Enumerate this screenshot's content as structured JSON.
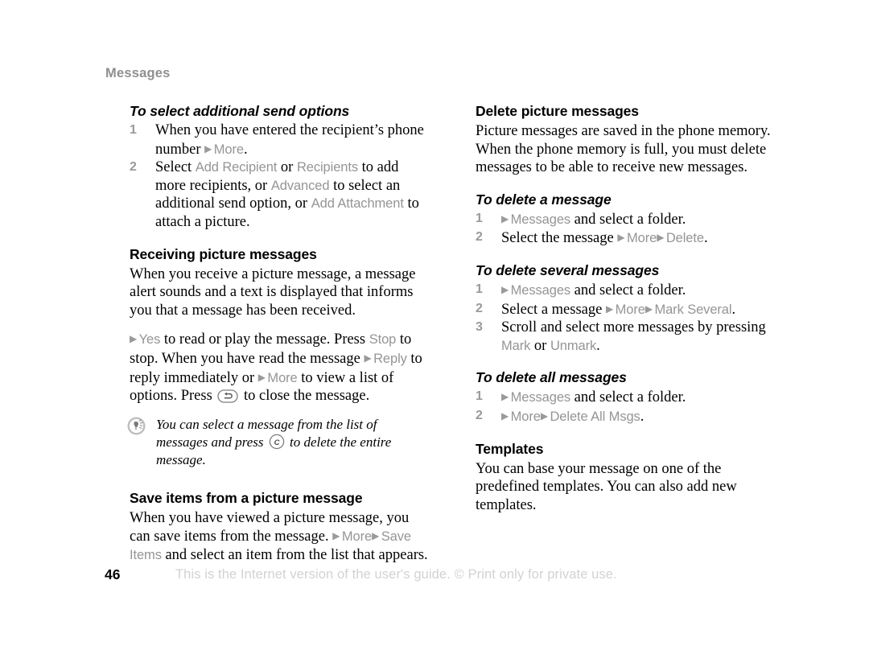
{
  "header": {
    "running_head": "Messages"
  },
  "colors": {
    "command_gray": "#959595",
    "running_head_gray": "#8f8f8f",
    "step_number_gray": "#9a9a9a",
    "footer_note_gray": "#d2d2d2",
    "body_black": "#000000"
  },
  "left_column": {
    "proc_send_options": {
      "heading": "To select additional send options",
      "steps": [
        {
          "num": "1",
          "parts": [
            {
              "type": "text",
              "value": "When you have entered the recipient’s phone number "
            },
            {
              "type": "arrow",
              "value": "▶"
            },
            {
              "type": "cmd",
              "value": "More"
            },
            {
              "type": "text",
              "value": "."
            }
          ]
        },
        {
          "num": "2",
          "parts": [
            {
              "type": "text",
              "value": "Select "
            },
            {
              "type": "cmd",
              "value": "Add Recipient"
            },
            {
              "type": "text",
              "value": " or "
            },
            {
              "type": "cmd",
              "value": "Recipients"
            },
            {
              "type": "text",
              "value": " to add more recipients, or "
            },
            {
              "type": "cmd",
              "value": "Advanced"
            },
            {
              "type": "text",
              "value": " to select an additional send option, or "
            },
            {
              "type": "cmd",
              "value": "Add Attachment"
            },
            {
              "type": "text",
              "value": " to attach a picture."
            }
          ]
        }
      ]
    },
    "sec_receiving": {
      "heading": "Receiving picture messages",
      "paragraph": "When you receive a picture message, a message alert sounds and a text is displayed that informs you that a message has been received.",
      "instruction_parts": [
        {
          "type": "arrow",
          "value": "▶"
        },
        {
          "type": "cmd",
          "value": "Yes"
        },
        {
          "type": "text",
          "value": " to read or play the message. Press "
        },
        {
          "type": "cmd",
          "value": "Stop"
        },
        {
          "type": "text",
          "value": " to stop. When you have read the message "
        },
        {
          "type": "arrow",
          "value": "▶"
        },
        {
          "type": "cmd",
          "value": "Reply"
        },
        {
          "type": "text",
          "value": " to reply immediately or "
        },
        {
          "type": "arrow",
          "value": "▶"
        },
        {
          "type": "cmd",
          "value": "More"
        },
        {
          "type": "text",
          "value": " to view a list of options. Press "
        },
        {
          "type": "key",
          "value": "back-key-icon"
        },
        {
          "type": "text",
          "value": " to close the message."
        }
      ]
    },
    "tip": {
      "icon": "lightbulb-tip-icon",
      "parts": [
        {
          "type": "text",
          "value": "You can select a message from the list of messages and press "
        },
        {
          "type": "key",
          "value": "clear-key-icon"
        },
        {
          "type": "text",
          "value": " to delete the entire message."
        }
      ]
    },
    "sec_save_items": {
      "heading": "Save items from a picture message",
      "parts": [
        {
          "type": "text",
          "value": "When you have viewed a picture message, you can save items from the message. "
        },
        {
          "type": "arrow",
          "value": "▶"
        },
        {
          "type": "cmd",
          "value": "More"
        },
        {
          "type": "arrow",
          "value": "▶"
        },
        {
          "type": "cmd",
          "value": "Save Items"
        },
        {
          "type": "text",
          "value": " and select an item from the list that appears."
        }
      ]
    }
  },
  "right_column": {
    "sec_delete": {
      "heading": "Delete picture messages",
      "paragraph": "Picture messages are saved in the phone memory. When the phone memory is full, you must delete messages to be able to receive new messages."
    },
    "proc_delete_one": {
      "heading": "To delete a message",
      "steps": [
        {
          "num": "1",
          "parts": [
            {
              "type": "arrow",
              "value": "▶"
            },
            {
              "type": "cmd",
              "value": "Messages"
            },
            {
              "type": "text",
              "value": " and select a folder."
            }
          ]
        },
        {
          "num": "2",
          "parts": [
            {
              "type": "text",
              "value": "Select the message "
            },
            {
              "type": "arrow",
              "value": "▶"
            },
            {
              "type": "cmd",
              "value": "More"
            },
            {
              "type": "arrow",
              "value": "▶"
            },
            {
              "type": "cmd",
              "value": "Delete"
            },
            {
              "type": "text",
              "value": "."
            }
          ]
        }
      ]
    },
    "proc_delete_several": {
      "heading": "To delete several messages",
      "steps": [
        {
          "num": "1",
          "parts": [
            {
              "type": "arrow",
              "value": "▶"
            },
            {
              "type": "cmd",
              "value": "Messages"
            },
            {
              "type": "text",
              "value": " and select a folder."
            }
          ]
        },
        {
          "num": "2",
          "parts": [
            {
              "type": "text",
              "value": "Select a message "
            },
            {
              "type": "arrow",
              "value": "▶"
            },
            {
              "type": "cmd",
              "value": "More"
            },
            {
              "type": "arrow",
              "value": "▶"
            },
            {
              "type": "cmd",
              "value": "Mark Several"
            },
            {
              "type": "text",
              "value": "."
            }
          ]
        },
        {
          "num": "3",
          "parts": [
            {
              "type": "text",
              "value": "Scroll and select more messages by pressing "
            },
            {
              "type": "cmd",
              "value": "Mark"
            },
            {
              "type": "text",
              "value": " or "
            },
            {
              "type": "cmd",
              "value": "Unmark"
            },
            {
              "type": "text",
              "value": "."
            }
          ]
        }
      ]
    },
    "proc_delete_all": {
      "heading": "To delete all messages",
      "steps": [
        {
          "num": "1",
          "parts": [
            {
              "type": "arrow",
              "value": "▶"
            },
            {
              "type": "cmd",
              "value": "Messages"
            },
            {
              "type": "text",
              "value": " and select a folder."
            }
          ]
        },
        {
          "num": "2",
          "parts": [
            {
              "type": "arrow",
              "value": "▶"
            },
            {
              "type": "cmd",
              "value": "More"
            },
            {
              "type": "arrow",
              "value": "▶"
            },
            {
              "type": "cmd",
              "value": "Delete All Msgs"
            },
            {
              "type": "text",
              "value": "."
            }
          ]
        }
      ]
    },
    "sec_templates": {
      "heading": "Templates",
      "paragraph": "You can base your message on one of the predefined templates. You can also add new templates."
    }
  },
  "footer": {
    "page_number": "46",
    "note": "This is the Internet version of the user's guide. © Print only for private use."
  }
}
